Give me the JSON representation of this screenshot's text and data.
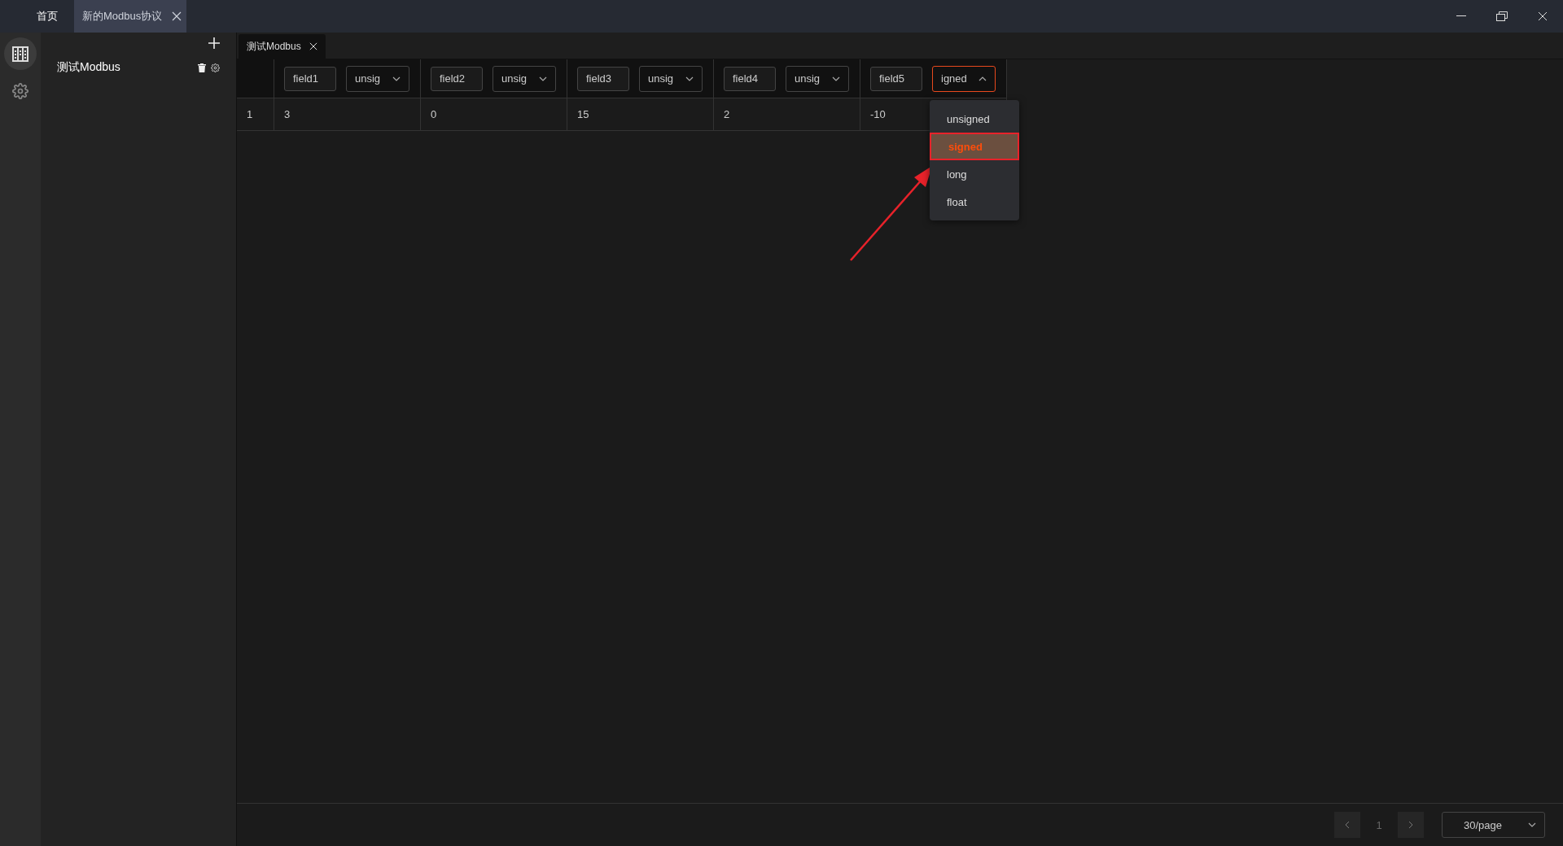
{
  "title_tabs": [
    {
      "label": "首页",
      "selected": false,
      "closable": false
    },
    {
      "label": "新的Modbus协议",
      "selected": true,
      "closable": true
    }
  ],
  "rail": [
    {
      "kind": "building",
      "selected": true
    },
    {
      "kind": "gear",
      "selected": false
    }
  ],
  "sidebar": {
    "items": [
      {
        "label": "测试Modbus"
      }
    ]
  },
  "doc_tabs": [
    {
      "label": "测试Modbus",
      "selected": true
    }
  ],
  "table": {
    "columns": [
      {
        "name": "field1",
        "type": "unsig",
        "open": false
      },
      {
        "name": "field2",
        "type": "unsig",
        "open": false
      },
      {
        "name": "field3",
        "type": "unsig",
        "open": false
      },
      {
        "name": "field4",
        "type": "unsig",
        "open": false
      },
      {
        "name": "field5",
        "type": "igned",
        "open": true
      }
    ],
    "rows": [
      {
        "index": "1",
        "cells": [
          "3",
          "0",
          "15",
          "2",
          "-10"
        ]
      }
    ]
  },
  "dropdown": {
    "options": [
      {
        "label": "unsigned",
        "selected": false
      },
      {
        "label": "signed",
        "selected": true
      },
      {
        "label": "long",
        "selected": false
      },
      {
        "label": "float",
        "selected": false
      }
    ]
  },
  "pagination": {
    "page": "1",
    "page_size": "30/page"
  }
}
